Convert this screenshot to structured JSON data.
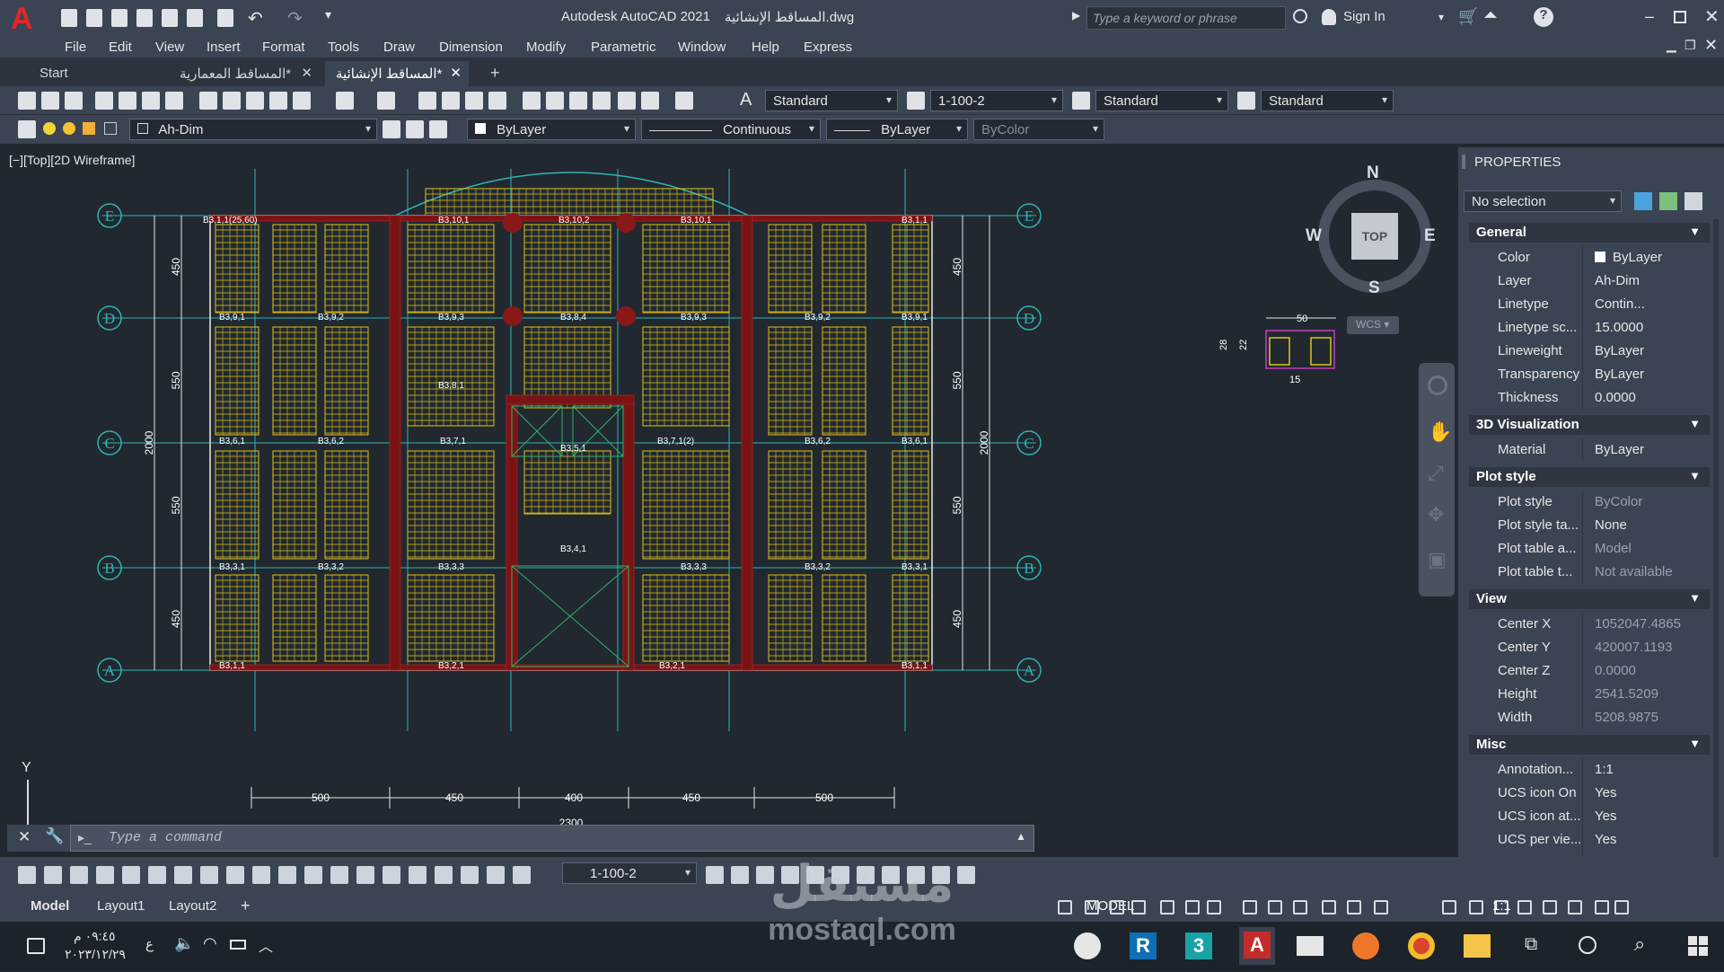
{
  "app": {
    "title": "Autodesk AutoCAD 2021",
    "filename": "المساقط الإنشائية.dwg",
    "search_placeholder": "Type a keyword or phrase",
    "sign_in": "Sign In"
  },
  "menu": [
    "File",
    "Edit",
    "View",
    "Insert",
    "Format",
    "Tools",
    "Draw",
    "Dimension",
    "Modify",
    "Parametric",
    "Window",
    "Help",
    "Express"
  ],
  "tabs": [
    {
      "label": "Start",
      "active": false
    },
    {
      "label": "المساقط المعمارية*",
      "active": false
    },
    {
      "label": "المساقط الإنشائية*",
      "active": true
    }
  ],
  "ribbon1": {
    "text_style": "Standard",
    "dim_style": "1-100-2",
    "table_style": "Standard",
    "mleader_style": "Standard"
  },
  "ribbon2": {
    "layer": "Ah-Dim",
    "color": "ByLayer",
    "linetype": "Continuous",
    "lineweight": "ByLayer",
    "plotstyle": "ByColor"
  },
  "viewport_label": "[−][Top][2D Wireframe]",
  "viewcube": {
    "n": "N",
    "s": "S",
    "e": "E",
    "w": "W",
    "top": "TOP",
    "wcs": "WCS"
  },
  "drawing": {
    "grid_labels": [
      "E",
      "D",
      "C",
      "B",
      "A"
    ],
    "left_dims": [
      "450",
      "550",
      "550",
      "450"
    ],
    "total_dim": "2000",
    "bottom_dims": [
      "500",
      "450",
      "400",
      "450",
      "500"
    ],
    "bottom_total": "2300",
    "beam_labels": [
      "B3,1,1(25,60)",
      "B3,10,1",
      "B3,10,2",
      "B3,10,1",
      "B3,1,1",
      "B3,9,1",
      "B3,9,2",
      "B3,9,3",
      "B3,8,4",
      "B3,9,3",
      "B3,9,2",
      "B3,9,1",
      "B3,6,1",
      "B3,6,2",
      "B3,7,1",
      "B3,5,1",
      "B3,7,1(2)",
      "B3,6,2",
      "B3,6,1",
      "B3,3,1",
      "B3,3,2",
      "B3,3,3",
      "B3,4,1",
      "B3,3,3",
      "B3,3,2",
      "B3,3,1",
      "B3,1,1",
      "B3,2,1",
      "B3,2,1",
      "B3,1,1",
      "B3,8,1"
    ],
    "section_dims": {
      "top": "50",
      "left1": "28",
      "left2": "22",
      "bottom": "15"
    }
  },
  "command": {
    "placeholder": "Type a command"
  },
  "layout_tabs": [
    "Model",
    "Layout1",
    "Layout2"
  ],
  "bottom_dimstyle": "1-100-2",
  "status": {
    "model": "MODEL",
    "scale": "1:1"
  },
  "properties": {
    "title": "PROPERTIES",
    "selection": "No selection",
    "sections": [
      {
        "name": "General",
        "rows": [
          {
            "label": "Color",
            "value": "ByLayer",
            "dim": false
          },
          {
            "label": "Layer",
            "value": "Ah-Dim",
            "dim": false
          },
          {
            "label": "Linetype",
            "value": "Contin...",
            "dim": false
          },
          {
            "label": "Linetype sc...",
            "value": "15.0000",
            "dim": false
          },
          {
            "label": "Lineweight",
            "value": "ByLayer",
            "dim": false
          },
          {
            "label": "Transparency",
            "value": "ByLayer",
            "dim": false
          },
          {
            "label": "Thickness",
            "value": "0.0000",
            "dim": false
          }
        ]
      },
      {
        "name": "3D Visualization",
        "rows": [
          {
            "label": "Material",
            "value": "ByLayer",
            "dim": false
          }
        ]
      },
      {
        "name": "Plot style",
        "rows": [
          {
            "label": "Plot style",
            "value": "ByColor",
            "dim": true
          },
          {
            "label": "Plot style ta...",
            "value": "None",
            "dim": false
          },
          {
            "label": "Plot table a...",
            "value": "Model",
            "dim": true
          },
          {
            "label": "Plot table t...",
            "value": "Not available",
            "dim": true
          }
        ]
      },
      {
        "name": "View",
        "rows": [
          {
            "label": "Center X",
            "value": "1052047.4865",
            "dim": true
          },
          {
            "label": "Center Y",
            "value": "420007.1193",
            "dim": true
          },
          {
            "label": "Center Z",
            "value": "0.0000",
            "dim": true
          },
          {
            "label": "Height",
            "value": "2541.5209",
            "dim": true
          },
          {
            "label": "Width",
            "value": "5208.9875",
            "dim": true
          }
        ]
      },
      {
        "name": "Misc",
        "rows": [
          {
            "label": "Annotation...",
            "value": "1:1",
            "dim": false
          },
          {
            "label": "UCS icon On",
            "value": "Yes",
            "dim": false
          },
          {
            "label": "UCS icon at...",
            "value": "Yes",
            "dim": false
          },
          {
            "label": "UCS per vie...",
            "value": "Yes",
            "dim": false
          },
          {
            "label": "UCS Name",
            "value": "",
            "dim": false
          }
        ]
      }
    ]
  },
  "taskbar": {
    "time": "٠٩:٤٥ م",
    "date": "٢٠٢٣/١٢/٢٩",
    "lang": "ع"
  },
  "watermark": {
    "ar": "مستقل",
    "en": "mostaql.com"
  }
}
